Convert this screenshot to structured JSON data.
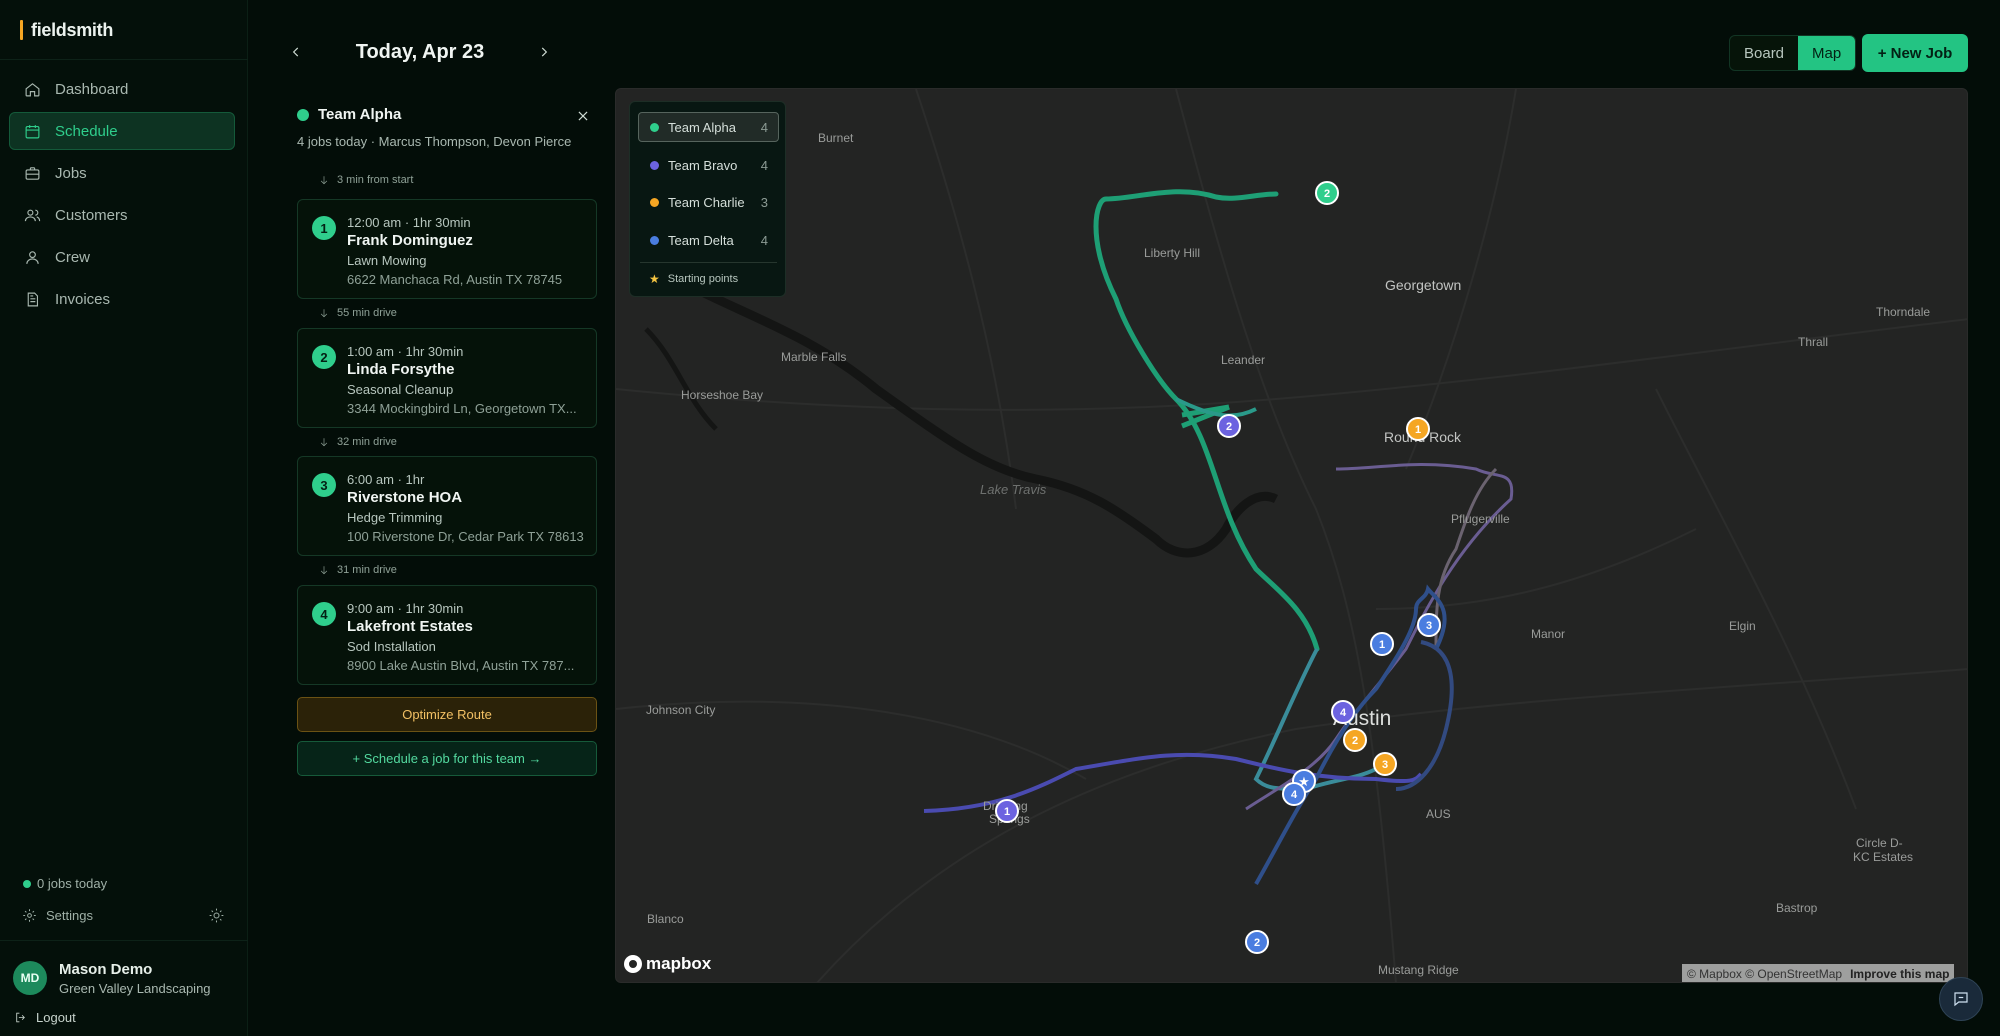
{
  "brand": {
    "name": "fieldsmith"
  },
  "nav": [
    {
      "label": "Dashboard",
      "icon": "home-icon",
      "active": false
    },
    {
      "label": "Schedule",
      "icon": "calendar-icon",
      "active": true
    },
    {
      "label": "Jobs",
      "icon": "briefcase-icon",
      "active": false
    },
    {
      "label": "Customers",
      "icon": "users-icon",
      "active": false
    },
    {
      "label": "Crew",
      "icon": "user-icon",
      "active": false
    },
    {
      "label": "Invoices",
      "icon": "document-icon",
      "active": false
    }
  ],
  "sidebar": {
    "status": "0 jobs today",
    "settings": "Settings",
    "logout": "Logout",
    "user": {
      "initials": "MD",
      "name": "Mason Demo",
      "org": "Green Valley Landscaping"
    }
  },
  "header": {
    "date": "Today, Apr 23",
    "view_board": "Board",
    "view_map": "Map",
    "active_view": "Map",
    "new_job": "+ New Job"
  },
  "team": {
    "name": "Team Alpha",
    "color": "#2fce8c",
    "summary": "4 jobs today · Marcus Thompson, Devon Pierce",
    "first_drive": "3 min from start",
    "jobs": [
      {
        "num": "1",
        "time": "12:00 am · 1hr 30min",
        "client": "Frank Dominguez",
        "service": "Lawn Mowing",
        "address": "6622 Manchaca Rd, Austin TX 78745",
        "drive_after": "55 min drive"
      },
      {
        "num": "2",
        "time": "1:00 am · 1hr 30min",
        "client": "Linda Forsythe",
        "service": "Seasonal Cleanup",
        "address": "3344 Mockingbird Ln, Georgetown TX...",
        "drive_after": "32 min drive"
      },
      {
        "num": "3",
        "time": "6:00 am · 1hr",
        "client": "Riverstone HOA",
        "service": "Hedge Trimming",
        "address": "100 Riverstone Dr, Cedar Park TX 78613",
        "drive_after": "31 min drive"
      },
      {
        "num": "4",
        "time": "9:00 am · 1hr 30min",
        "client": "Lakefront Estates",
        "service": "Sod Installation",
        "address": "8900 Lake Austin Blvd, Austin TX 787...",
        "drive_after": ""
      }
    ],
    "optimize": "Optimize Route",
    "schedule_cta": "+ Schedule a job for this team →"
  },
  "legend": {
    "teams": [
      {
        "name": "Team Alpha",
        "count": "4",
        "color": "#2fce8c",
        "active": true
      },
      {
        "name": "Team Bravo",
        "count": "4",
        "color": "#6c63e0",
        "active": false
      },
      {
        "name": "Team Charlie",
        "count": "3",
        "color": "#f5a623",
        "active": false
      },
      {
        "name": "Team Delta",
        "count": "4",
        "color": "#4a7de0",
        "active": false
      }
    ],
    "starting_points": "Starting points"
  },
  "map": {
    "places": {
      "burnet": "Burnet",
      "liberty_hill": "Liberty Hill",
      "georgetown": "Georgetown",
      "thorndale": "Thorndale",
      "thrall": "Thrall",
      "marble_falls": "Marble Falls",
      "leander": "Leander",
      "horseshoe_bay": "Horseshoe Bay",
      "round_rock": "Round Rock",
      "lake_travis": "Lake Travis",
      "pflugerville": "Pflugerville",
      "manor": "Manor",
      "elgin": "Elgin",
      "johnson_city": "Johnson City",
      "austin": "Austin",
      "dripping_springs_1": "Dripping",
      "dripping_springs_2": "Springs",
      "aus": "AUS",
      "circle_d_1": "Circle D-",
      "circle_d_2": "KC Estates",
      "blanco": "Blanco",
      "bastrop": "Bastrop",
      "mustang_ridge": "Mustang Ridge"
    },
    "markers": [
      {
        "team": "Alpha",
        "num": "2"
      },
      {
        "team": "Bravo",
        "num": "2"
      },
      {
        "team": "Charlie",
        "num": "1"
      },
      {
        "team": "Delta",
        "num": "3"
      },
      {
        "team": "Delta",
        "num": "1"
      },
      {
        "team": "Bravo",
        "num": "4"
      },
      {
        "team": "Charlie",
        "num": "2"
      },
      {
        "team": "Charlie",
        "num": "3"
      },
      {
        "team": "Delta",
        "num": "4"
      },
      {
        "team": "Bravo",
        "num": "1"
      },
      {
        "team": "Delta",
        "num": "2"
      }
    ],
    "brand": "mapbox",
    "attribution": "© Mapbox © OpenStreetMap",
    "improve": "Improve this map"
  }
}
